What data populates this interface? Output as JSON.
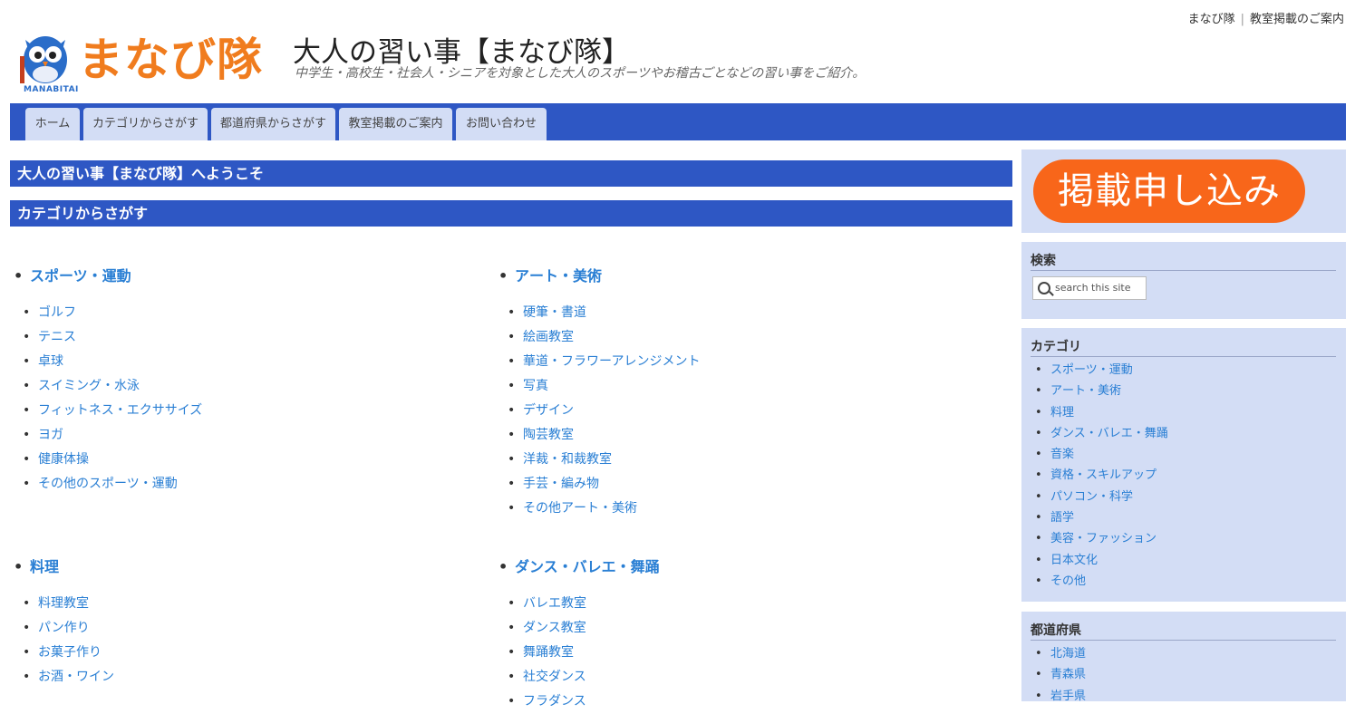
{
  "top_links": [
    "まなび隊",
    "教室掲載のご案内"
  ],
  "logo": {
    "brand": "まなび隊",
    "sub": "MANABITAI"
  },
  "site": {
    "title": "大人の習い事【まなび隊】",
    "tagline": "中学生・高校生・社会人・シニアを対象とした大人のスポーツやお稽古ごとなどの習い事をご紹介。"
  },
  "nav": [
    "ホーム",
    "カテゴリからさがす",
    "都道府県からさがす",
    "教室掲載のご案内",
    "お問い合わせ"
  ],
  "main": {
    "welcome": "大人の習い事【まなび隊】へようこそ",
    "category_heading": "カテゴリからさがす",
    "categories": [
      {
        "name": "スポーツ・運動",
        "items": [
          "ゴルフ",
          "テニス",
          "卓球",
          "スイミング・水泳",
          "フィットネス・エクササイズ",
          "ヨガ",
          "健康体操",
          "その他のスポーツ・運動"
        ]
      },
      {
        "name": "アート・美術",
        "items": [
          "硬筆・書道",
          "絵画教室",
          "華道・フラワーアレンジメント",
          "写真",
          "デザイン",
          "陶芸教室",
          "洋裁・和裁教室",
          "手芸・編み物",
          "その他アート・美術"
        ]
      },
      {
        "name": "料理",
        "items": [
          "料理教室",
          "パン作り",
          "お菓子作り",
          "お酒・ワイン"
        ]
      },
      {
        "name": "ダンス・バレエ・舞踊",
        "items": [
          "バレエ教室",
          "ダンス教室",
          "舞踊教室",
          "社交ダンス",
          "フラダンス"
        ]
      }
    ]
  },
  "sidebar": {
    "apply_button": "掲載申し込み",
    "search": {
      "title": "検索",
      "placeholder": "search this site"
    },
    "categories": {
      "title": "カテゴリ",
      "items": [
        "スポーツ・運動",
        "アート・美術",
        "料理",
        "ダンス・バレエ・舞踊",
        "音楽",
        "資格・スキルアップ",
        "パソコン・科学",
        "語学",
        "美容・ファッション",
        "日本文化",
        "その他"
      ]
    },
    "prefectures": {
      "title": "都道府県",
      "items": [
        "北海道",
        "青森県",
        "岩手県"
      ]
    }
  },
  "colors": {
    "nav_blue": "#2e57c4",
    "tab_bg": "#d3ddf5",
    "brand_orange": "#f07c1e",
    "apply_orange": "#f8661a",
    "link_blue": "#2a7fd4"
  }
}
